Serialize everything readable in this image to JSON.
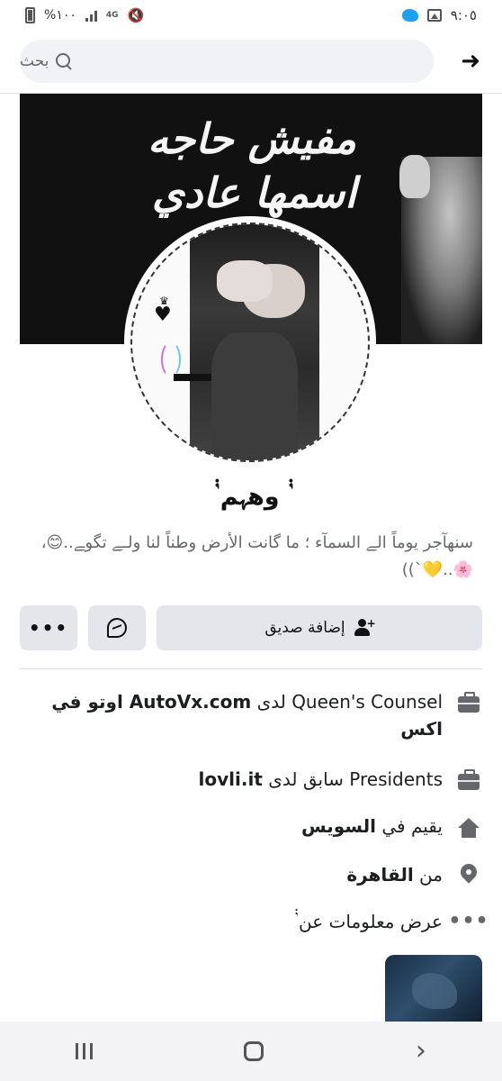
{
  "status_bar": {
    "time": "٩:٠٥",
    "battery": "%١٠٠",
    "network": "4G"
  },
  "search": {
    "placeholder": "بحث"
  },
  "cover": {
    "line1": "مفيش حاجه",
    "line2": "اسمها عادي"
  },
  "profile": {
    "name": "ٰٰ۬۬ وهہم ٰٰ۬۬",
    "bio": "سنهآجر يوماً الے السمآء ؛ ما گانت الأرض وطناً لنا ولـﮯ تگوﮯ..😊،🌸..💛`))"
  },
  "actions": {
    "add_friend": "إضافة صديق",
    "more": "•••"
  },
  "info": [
    {
      "icon": "briefcase-icon",
      "prefix": "Queen's Counsel لدى ",
      "bold": "AutoVx.com  اوتو في اكس"
    },
    {
      "icon": "briefcase-icon",
      "prefix": "Presidents سابق لدى ",
      "bold": "lovli.it"
    },
    {
      "icon": "home-icon",
      "prefix": "يقيم في ",
      "bold": "السويس"
    },
    {
      "icon": "location-pin-icon",
      "prefix": "من ",
      "bold": "القاهرة"
    },
    {
      "icon": "more-dots-icon",
      "prefix": "عرض معلومات عن ٰٰ۬۬",
      "bold": ""
    }
  ]
}
